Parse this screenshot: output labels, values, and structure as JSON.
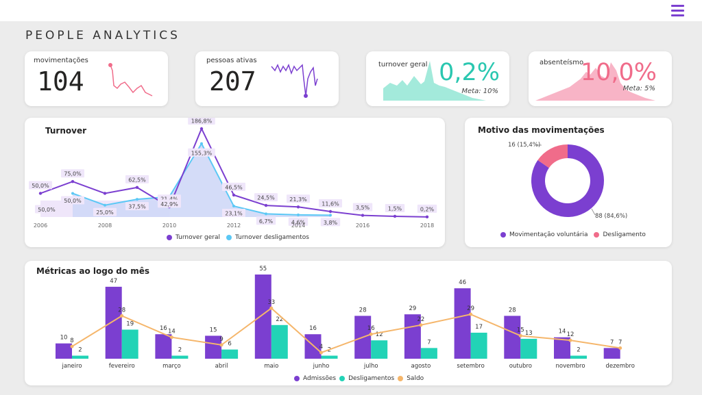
{
  "header": {
    "title": "PEOPLE ANALYTICS",
    "menu_icon": "hamburger-menu-icon"
  },
  "colors": {
    "purple": "#7b3fd0",
    "cyan": "#5bc8f5",
    "teal": "#22d3b6",
    "pink": "#f06c8a",
    "orange": "#f5b66b"
  },
  "kpis": {
    "movimentacoes": {
      "label": "movimentações",
      "value": "104"
    },
    "pessoas_ativas": {
      "label": "pessoas ativas",
      "value": "207"
    },
    "turnover_geral": {
      "label": "turnover geral",
      "value": "0,2%",
      "meta": "Meta: 10%"
    },
    "absenteismo": {
      "label": "absenteísmo",
      "value": "10,0%",
      "meta": "Meta: 5%"
    }
  },
  "turnover": {
    "title": "Turnover"
  },
  "motivo": {
    "title": "Motivo das movimentações"
  },
  "metricas": {
    "title": "Métricas ao logo do mês"
  },
  "chart_data": [
    {
      "type": "line",
      "title": "Turnover",
      "x": [
        2006,
        2007,
        2008,
        2009,
        2010,
        2011,
        2012,
        2013,
        2014,
        2015,
        2016,
        2017,
        2018
      ],
      "xticks": [
        "2006",
        "2008",
        "2010",
        "2012",
        "2014",
        "2016",
        "2018"
      ],
      "series": [
        {
          "name": "Turnover geral",
          "values": [
            50.0,
            75.0,
            50.0,
            62.5,
            21.4,
            186.8,
            46.5,
            24.5,
            21.3,
            11.6,
            3.5,
            1.5,
            0.2
          ],
          "labels": [
            "50,0%",
            "75,0%",
            "",
            "62,5%",
            "21,4%",
            "186,8%",
            "46,5%",
            "24,5%",
            "21,3%",
            "11,6%",
            "3,5%",
            "1,5%",
            "0,2%"
          ]
        },
        {
          "name": "Turnover desligamentos",
          "values": [
            null,
            50.0,
            25.0,
            37.5,
            42.9,
            155.3,
            23.1,
            6.7,
            4.6,
            3.8,
            null,
            null,
            null
          ],
          "labels": [
            "",
            "50,0%",
            "25,0%",
            "37,5%",
            "42,9%",
            "155,3%",
            "23,1%",
            "6,7%",
            "4,6%",
            "3,8%",
            "",
            "",
            ""
          ]
        }
      ],
      "extra_labels": [
        "50,0%"
      ],
      "legend": "bottom"
    },
    {
      "type": "pie",
      "title": "Motivo das movimentações",
      "slices": [
        {
          "name": "Movimentação voluntária",
          "value": 88,
          "label": "88 (84,6%)"
        },
        {
          "name": "Desligamento",
          "value": 16,
          "label": "16 (15,4%)"
        }
      ],
      "legend": "bottom"
    },
    {
      "type": "bar",
      "title": "Métricas ao logo do mês",
      "categories": [
        "janeiro",
        "fevereiro",
        "março",
        "abril",
        "maio",
        "junho",
        "julho",
        "agosto",
        "setembro",
        "outubro",
        "novembro",
        "dezembro"
      ],
      "series": [
        {
          "name": "Admissões",
          "values": [
            10,
            47,
            16,
            15,
            55,
            16,
            28,
            29,
            46,
            28,
            14,
            7
          ]
        },
        {
          "name": "Desligamentos",
          "values": [
            2,
            19,
            2,
            6,
            22,
            2,
            12,
            7,
            17,
            13,
            2,
            null
          ]
        },
        {
          "name": "Saldo",
          "type": "line",
          "values": [
            8,
            28,
            14,
            9,
            33,
            4,
            16,
            22,
            29,
            15,
            12,
            7
          ]
        }
      ],
      "legend": "bottom"
    }
  ]
}
